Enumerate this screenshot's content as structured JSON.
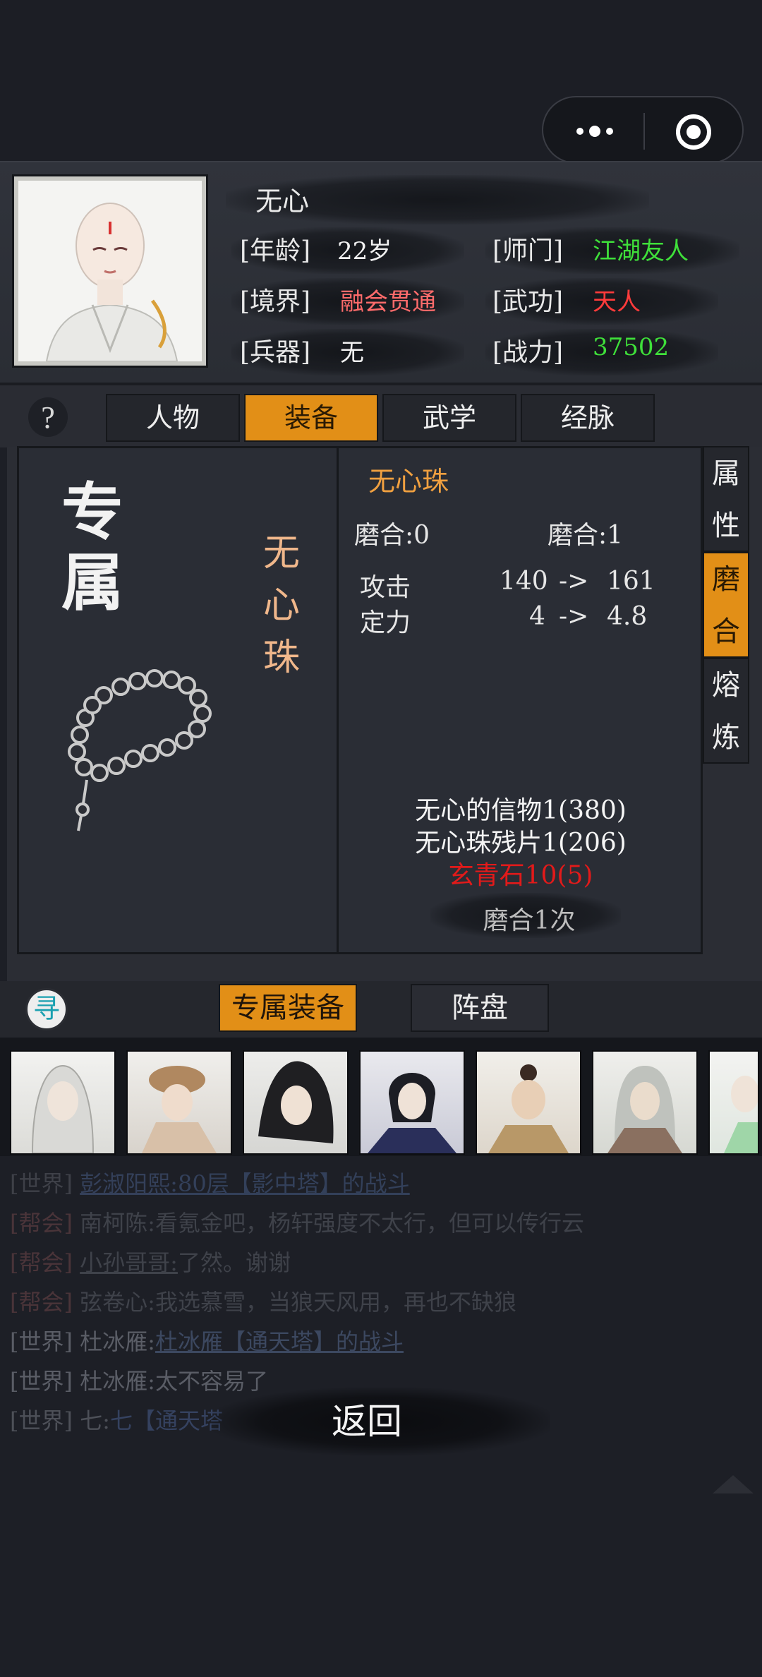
{
  "profile": {
    "name": "无心",
    "rows": [
      {
        "label": "[年龄]",
        "value": "22岁"
      },
      {
        "label": "[师门]",
        "value": "江湖友人"
      },
      {
        "label": "[境界]",
        "value": "融会贯通"
      },
      {
        "label": "[武功]",
        "value": "天人"
      },
      {
        "label": "[兵器]",
        "value": "无"
      },
      {
        "label": "[战力]",
        "value": "37502"
      }
    ]
  },
  "tabs": [
    "人物",
    "装备",
    "武学",
    "经脉"
  ],
  "active_tab": "装备",
  "side_tabs": [
    {
      "chars": [
        "属",
        "性"
      ]
    },
    {
      "chars": [
        "磨",
        "合"
      ]
    },
    {
      "chars": [
        "熔",
        "炼"
      ]
    }
  ],
  "equipment": {
    "badge": [
      "专",
      "属"
    ],
    "name_vertical": [
      "无",
      "心",
      "珠"
    ],
    "title": "无心珠",
    "mohe_from": "磨合:0",
    "mohe_to": "磨合:1",
    "stats": [
      {
        "name": "攻击",
        "from": "140",
        "arrow": "->",
        "to": "161"
      },
      {
        "name": "定力",
        "from": "4",
        "arrow": "->",
        "to": "4.8"
      }
    ],
    "materials": [
      {
        "text": "无心的信物1(380)",
        "color": "#f5f5f5"
      },
      {
        "text": "无心珠残片1(206)",
        "color": "#f5f5f5"
      },
      {
        "text": "玄青石10(5)",
        "color": "#e21a1a"
      }
    ],
    "action_label": "磨合1次"
  },
  "bottom_tabs": [
    "专属装备",
    "阵盘"
  ],
  "seek_label": "寻",
  "chat": [
    {
      "channel": "[世界]",
      "speaker": "彭淑阳熙:",
      "pre": "",
      "link": "80层【影中塔】的战斗",
      "post": ""
    },
    {
      "channel": "[帮会]",
      "speaker": "南柯陈:",
      "pre": "看氪金吧，杨轩强度不太行，但可以传行云",
      "link": "",
      "post": ""
    },
    {
      "channel": "[帮会]",
      "speaker": "小孙哥哥:",
      "pre": "了然。谢谢",
      "link": "",
      "post": ""
    },
    {
      "channel": "[帮会]",
      "speaker": "弦卷心:",
      "pre": "我选慕雪，当狼天风用，再也不缺狼",
      "link": "",
      "post": ""
    },
    {
      "channel": "[世界]",
      "speaker": "杜冰雁:",
      "pre": "",
      "link": "杜冰雁【通天塔】的战斗",
      "post": ""
    },
    {
      "channel": "[世界]",
      "speaker": "杜冰雁:",
      "pre": "太不容易了",
      "link": "",
      "post": ""
    },
    {
      "channel": "[世界]",
      "speaker": "七:",
      "pre": "",
      "link": "七【通天塔",
      "post": ""
    }
  ],
  "back_label": "返回",
  "colors": {
    "accent": "#e28f17",
    "green_value": "#3fe03a",
    "red_value": "#ff3b3b",
    "realm_value": "#ff6b6b"
  }
}
